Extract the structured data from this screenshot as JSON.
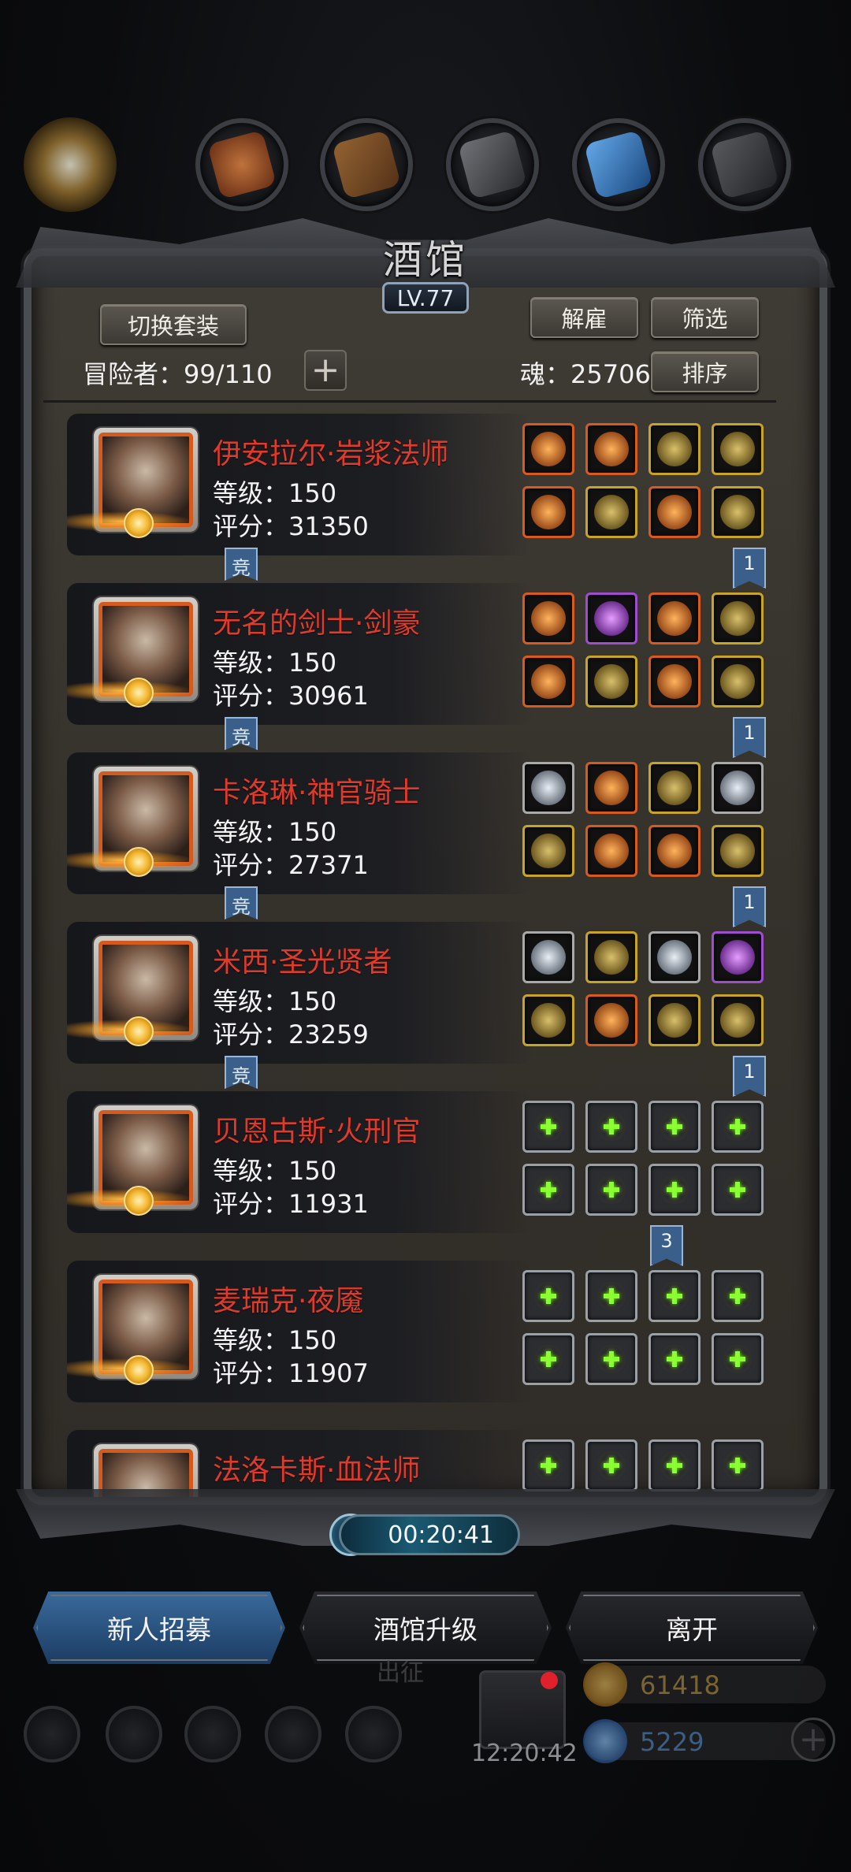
{
  "header": {
    "title": "酒馆",
    "level": "LV.77",
    "tabs": [
      {
        "name": "guild-emblem",
        "color": "#caa765"
      },
      {
        "name": "hammer-tab",
        "color": "#b2592c"
      },
      {
        "name": "wood-tab",
        "color": "#8a5a2a"
      },
      {
        "name": "iron-tab",
        "color": "#5c5c60"
      },
      {
        "name": "crystal-tab",
        "color": "#3c86c8"
      },
      {
        "name": "stone-tab",
        "color": "#4b4c50"
      }
    ]
  },
  "toolbar": {
    "switch_set": "切换套装",
    "dismiss": "解雇",
    "filter": "筛选",
    "sort": "排序",
    "adventurers": "冒险者：99/110",
    "add": "+",
    "soul": "魂：25706"
  },
  "tags": {
    "compete": "竞"
  },
  "heroes": [
    {
      "name": "伊安拉尔·岩浆法师",
      "level": "等级：150",
      "score": "评分：31350",
      "compete": true,
      "rank_tag": "1",
      "gear": [
        "orange",
        "orange",
        "gold",
        "gold",
        "orange",
        "gold",
        "orange",
        "gold"
      ]
    },
    {
      "name": "无名的剑士·剑豪",
      "level": "等级：150",
      "score": "评分：30961",
      "compete": true,
      "rank_tag": "1",
      "gear": [
        "orange",
        "purple",
        "orange",
        "gold",
        "orange",
        "gold",
        "orange",
        "gold"
      ]
    },
    {
      "name": "卡洛琳·神官骑士",
      "level": "等级：150",
      "score": "评分：27371",
      "compete": true,
      "rank_tag": "1",
      "gear": [
        "grey",
        "orange",
        "gold",
        "grey",
        "gold",
        "orange",
        "orange",
        "gold"
      ]
    },
    {
      "name": "米西·圣光贤者",
      "level": "等级：150",
      "score": "评分：23259",
      "compete": true,
      "rank_tag": "1",
      "gear": [
        "grey",
        "gold",
        "grey",
        "purple",
        "gold",
        "orange",
        "gold",
        "gold"
      ]
    },
    {
      "name": "贝恩古斯·火刑官",
      "level": "等级：150",
      "score": "评分：11931",
      "compete": false,
      "rank_tag": "3",
      "gear": [
        "empty",
        "empty",
        "empty",
        "empty",
        "empty",
        "empty",
        "empty",
        "empty"
      ]
    },
    {
      "name": "麦瑞克·夜魇",
      "level": "等级：150",
      "score": "评分：11907",
      "compete": false,
      "rank_tag": "",
      "gear": [
        "empty",
        "empty",
        "empty",
        "empty",
        "empty",
        "empty",
        "empty",
        "empty"
      ]
    },
    {
      "name": "法洛卡斯·血法师",
      "level": "",
      "score": "",
      "compete": false,
      "rank_tag": "",
      "gear": [
        "empty",
        "empty",
        "empty",
        "empty"
      ]
    }
  ],
  "timer": "00:20:41",
  "actions": {
    "recruit": "新人招募",
    "upgrade": "酒馆升级",
    "leave": "离开"
  },
  "footer": {
    "expedition": "出征",
    "clock": "12:20:42",
    "gold": "61418",
    "gems": "5229",
    "plus": "+"
  }
}
